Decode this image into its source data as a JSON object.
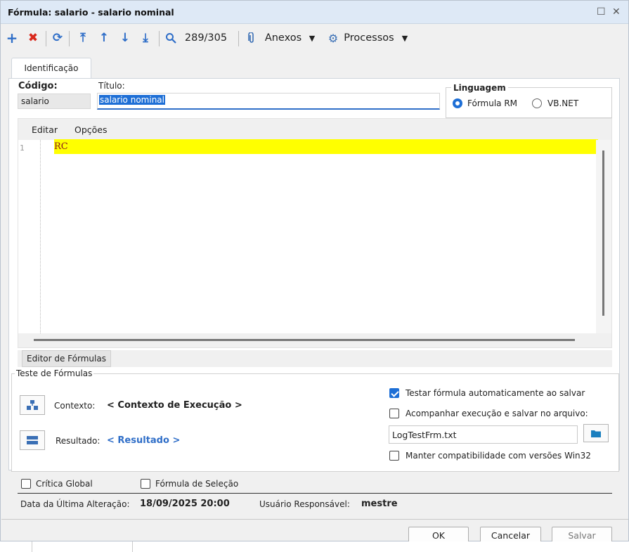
{
  "window": {
    "title": "Fórmula: salario - salario nominal",
    "maximize_glyph": "☐",
    "close_glyph": "✕"
  },
  "toolbar": {
    "record_counter": "289/305",
    "attachments_label": "Anexos",
    "processes_label": "Processos",
    "icons": [
      "add-icon",
      "delete-icon",
      "refresh-icon",
      "first-record-icon",
      "previous-record-icon",
      "next-record-icon",
      "last-record-icon",
      "search-icon",
      "paperclip-icon",
      "gear-icon"
    ]
  },
  "tab": {
    "identification": "Identificação"
  },
  "form": {
    "code_label": "Código:",
    "code_value": "salario",
    "title_label": "Título:",
    "title_value": "salario nominal",
    "language_label": "Linguagem",
    "language_options": [
      "Fórmula RM",
      "VB.NET"
    ],
    "language_selected": "Fórmula RM"
  },
  "editor": {
    "menu": [
      "Editar",
      "Opções"
    ],
    "line_number": "1",
    "code": "RC",
    "tab_label": "Editor de Fórmulas"
  },
  "test": {
    "legend": "Teste de Fórmulas",
    "context_label": "Contexto:",
    "context_value": "< Contexto de Execução >",
    "result_label": "Resultado:",
    "result_value": "< Resultado >",
    "auto_test_label": "Testar fórmula automaticamente ao salvar",
    "auto_test_checked": true,
    "follow_label": "Acompanhar execução e salvar no arquivo:",
    "follow_checked": false,
    "log_file": "LogTestFrm.txt",
    "compat_label": "Manter compatibilidade com versões Win32",
    "compat_checked": false
  },
  "footer": {
    "global_critique": "Crítica Global",
    "selection_formula": "Fórmula de Seleção",
    "last_change_label": "Data da Última Alteração:",
    "last_change_value": "18/09/2025 20:00",
    "user_label": "Usuário Responsável:",
    "user_value": "mestre"
  },
  "buttons": {
    "ok": "OK",
    "cancel": "Cancelar",
    "save": "Salvar"
  },
  "colors": {
    "accent": "#1e6fd6",
    "highlight": "#ffff00",
    "delete": "#d9281c",
    "link": "#2f6ec8"
  }
}
